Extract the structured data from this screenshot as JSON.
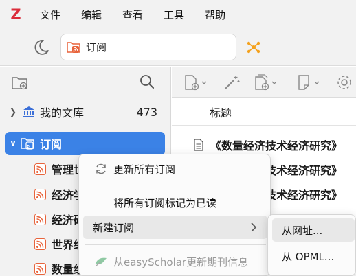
{
  "app": {
    "logo": "Z"
  },
  "menubar": {
    "items": [
      "文件",
      "编辑",
      "查看",
      "工具",
      "帮助"
    ]
  },
  "tab": {
    "label": "订阅"
  },
  "collections": {
    "library": {
      "label": "我的文库",
      "count": "473"
    },
    "feeds": {
      "label": "订阅"
    },
    "feed_items": [
      "管理世",
      "经济学",
      "经济研",
      "世界经",
      "数量经"
    ]
  },
  "items": {
    "column_title": "标题",
    "rows": [
      "《数量经济技术经济研究》",
      "《数量经济技术经济研究》",
      "《数量经济技术经济研究》",
      "",
      ""
    ]
  },
  "context_menu": {
    "items": [
      {
        "label": "更新所有订阅"
      },
      {
        "label": "将所有订阅标记为已读"
      },
      {
        "label": "新建订阅"
      },
      {
        "label": "从easyScholar更新期刊信息"
      }
    ]
  },
  "submenu": {
    "items": [
      "从网址...",
      "从 OPML..."
    ]
  },
  "colors": {
    "accent": "#3b82e6",
    "logo": "#db2c3a",
    "rss": "#e8643c",
    "sparkle": "#f4a21e"
  }
}
